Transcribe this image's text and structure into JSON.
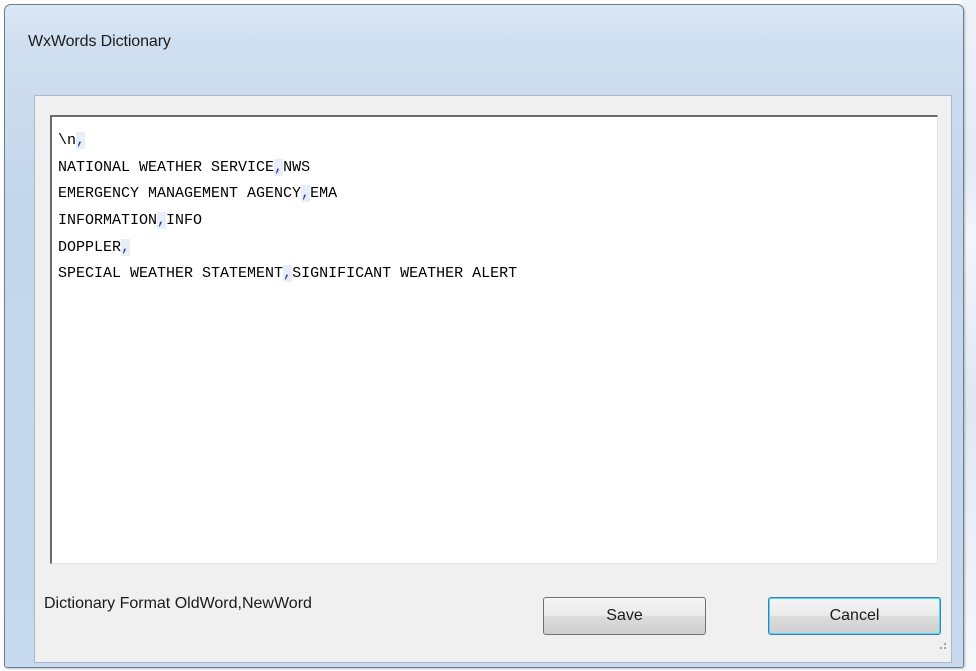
{
  "window": {
    "title": "WxWords Dictionary"
  },
  "editor": {
    "lines": [
      [
        "\\n",
        ",",
        ""
      ],
      [
        "NATIONAL WEATHER SERVICE",
        ",",
        "NWS"
      ],
      [
        "EMERGENCY MANAGEMENT AGENCY",
        ",",
        "EMA"
      ],
      [
        "INFORMATION",
        ",",
        "INFO"
      ],
      [
        "DOPPLER",
        ",",
        ""
      ],
      [
        "SPECIAL WEATHER STATEMENT",
        ",",
        "SIGNIFICANT WEATHER ALERT"
      ]
    ]
  },
  "footer": {
    "format_label": "Dictionary Format OldWord,NewWord",
    "save_label": "Save",
    "cancel_label": "Cancel"
  },
  "icons": {
    "resize_grip": "resize-grip-icon"
  },
  "colors": {
    "titlebar": "#dce8f5",
    "client_background": "#f0f0f0",
    "editor_background": "#ffffff",
    "default_button_border": "#3c7fb1"
  }
}
